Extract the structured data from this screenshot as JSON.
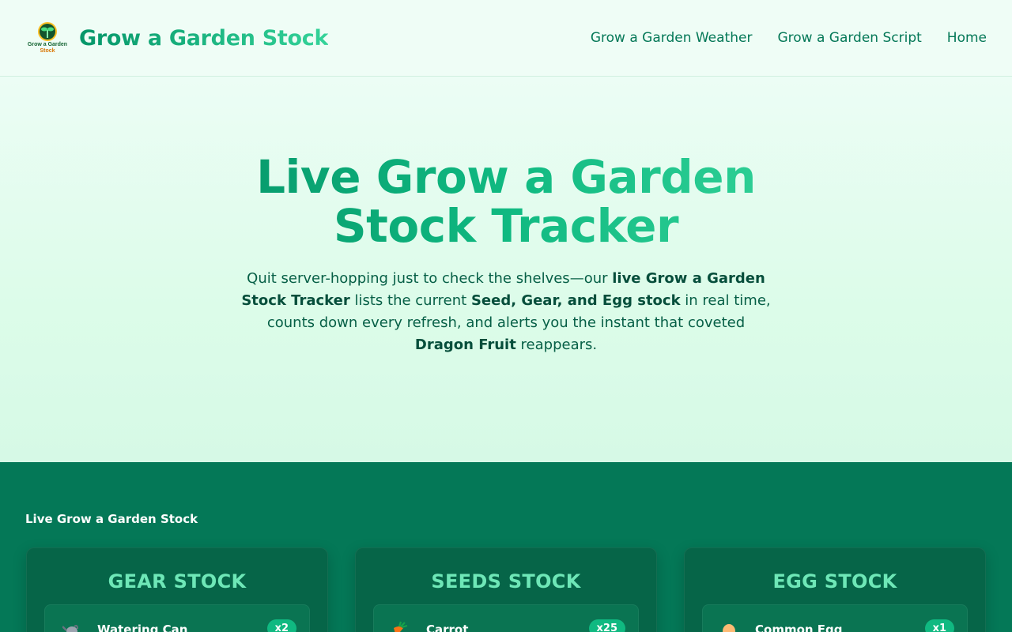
{
  "header": {
    "logo_text_top": "Grow a Garden",
    "logo_text_bottom": "Stock",
    "title": "Grow a Garden Stock",
    "nav": [
      {
        "label": "Grow a Garden Weather"
      },
      {
        "label": "Grow a Garden Script"
      },
      {
        "label": "Home"
      }
    ]
  },
  "hero": {
    "title": "Live Grow a Garden Stock Tracker",
    "intro_1": "Quit server-hopping just to check the shelves—our ",
    "intro_b1": "live Grow a Garden Stock Tracker",
    "intro_2": " lists the current ",
    "intro_b2": "Seed, Gear, and Egg stock",
    "intro_3": " in real time, counts down every refresh, and alerts you the instant that coveted ",
    "intro_b3": "Dragon Fruit",
    "intro_4": " reappears."
  },
  "stock": {
    "section_label": "Live Grow a Garden Stock",
    "cards": [
      {
        "title": "GEAR STOCK",
        "item": {
          "name": "Watering Can",
          "qty": "x2",
          "icon": "watering-can-icon"
        }
      },
      {
        "title": "SEEDS STOCK",
        "item": {
          "name": "Carrot",
          "qty": "x25",
          "icon": "carrot-icon"
        }
      },
      {
        "title": "EGG STOCK",
        "item": {
          "name": "Common Egg",
          "qty": "x1",
          "icon": "egg-icon"
        }
      }
    ]
  },
  "colors": {
    "accent": "#059669",
    "accent_light": "#34d399",
    "section_bg": "#047857",
    "card_bg": "#066548",
    "badge": "#10b981"
  }
}
